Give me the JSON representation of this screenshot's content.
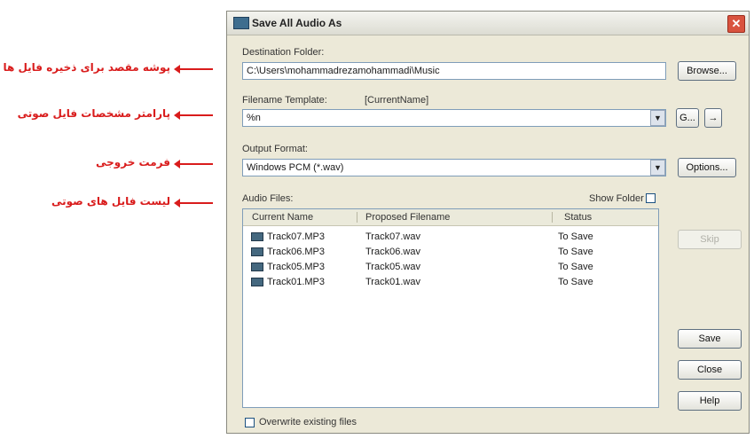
{
  "annotations": [
    "پوشه مقصد برای ذخیره فایل ها",
    "پارامتر مشخصات فایل صوتی",
    "فرمت خروجی",
    "لیست فایل های صوتی"
  ],
  "dialog": {
    "title": "Save All Audio As",
    "destination_label": "Destination Folder:",
    "destination_value": "C:\\Users\\mohammadrezamohammadi\\Music",
    "browse_label": "Browse...",
    "template_label": "Filename Template:",
    "template_hint": "[CurrentName]",
    "template_value": "%n",
    "template_btn1": "G...",
    "template_btn2": "→",
    "format_label": "Output Format:",
    "format_value": "Windows PCM (*.wav)",
    "options_label": "Options...",
    "audio_files_label": "Audio Files:",
    "show_folder_label": "Show Folder",
    "columns": [
      "Current Name",
      "Proposed Filename",
      "Status"
    ],
    "files": [
      {
        "current": "Track07.MP3",
        "proposed": "Track07.wav",
        "status": "To Save"
      },
      {
        "current": "Track06.MP3",
        "proposed": "Track06.wav",
        "status": "To Save"
      },
      {
        "current": "Track05.MP3",
        "proposed": "Track05.wav",
        "status": "To Save"
      },
      {
        "current": "Track01.MP3",
        "proposed": "Track01.wav",
        "status": "To Save"
      }
    ],
    "skip_label": "Skip",
    "save_label": "Save",
    "close_label": "Close",
    "help_label": "Help",
    "overwrite_label": "Overwrite existing files"
  }
}
